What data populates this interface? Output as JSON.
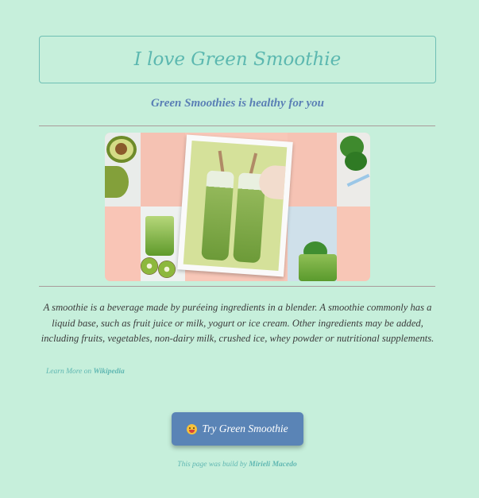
{
  "header": {
    "title": "I love Green Smoothie",
    "subtitle": "Green Smoothies is healthy for you"
  },
  "main": {
    "description": "A smoothie is a beverage made by puréeing ingredients in a blender. A smoothie commonly has a liquid base, such as fruit juice or milk, yogurt or ice cream. Other ingredients may be added, including fruits, vegetables, non-dairy milk, crushed ice, whey powder or nutritional supplements.",
    "learn_more_prefix": "Learn More on",
    "learn_more_link": "Wikipedia",
    "cta_label": "Try Green Smoothie",
    "cta_icon": "grinning-face-emoji"
  },
  "footer": {
    "prefix": "This page was build by",
    "author": "Mirieli Macedo"
  },
  "colors": {
    "background": "#c6efdb",
    "accent": "#5cb8b0",
    "button": "#5a84b6"
  }
}
